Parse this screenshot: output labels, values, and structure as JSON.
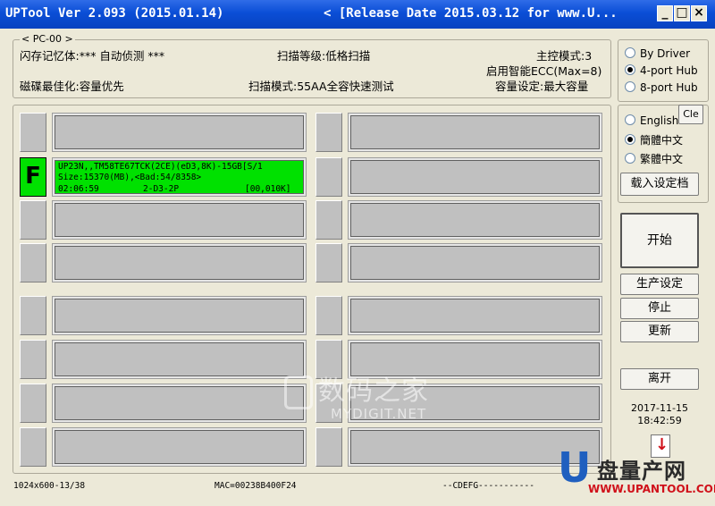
{
  "window": {
    "title": "UPTool Ver 2.093 (2015.01.14)",
    "title_right": "< [Release Date 2015.03.12 for www.U...",
    "minimize": "_",
    "maximize": "□",
    "close": "×"
  },
  "header": {
    "pc_label": "< PC-00 >",
    "flash_detect": "闪存记忆体:*** 自动侦测 ***",
    "scan_level": "扫描等级:低格扫描",
    "controller_mode": "主控模式:3",
    "ecc": "启用智能ECC(Max=8)",
    "optimize": "磁碟最佳化:容量优先",
    "scan_mode": "扫描模式:55AA全容快速测试",
    "capacity": "容量设定:最大容量"
  },
  "hub_options": {
    "selected": "4-port Hub",
    "items": [
      "By Driver",
      "4-port Hub",
      "8-port Hub"
    ]
  },
  "language_options": {
    "selected": "簡體中文",
    "items": [
      "English",
      "簡體中文",
      "繁體中文"
    ],
    "clear_button": "Cle",
    "load_button": "载入设定档"
  },
  "ports": {
    "active": {
      "status": "F",
      "line1": "UP23N,,TM58TE67TCK(2CE)(eD3,8K)-15GB[S/1",
      "line2": "Size:15370(MB),<Bad:54/8358>",
      "line3_time": "02:06:59",
      "line3_mode": "2-D3-2P",
      "line3_progress": "[00,010K]"
    }
  },
  "actions": {
    "start": "开始",
    "production_settings": "生产设定",
    "stop": "停止",
    "refresh": "更新",
    "exit": "离开"
  },
  "clock": {
    "date": "2017-11-15",
    "time": "18:42:59"
  },
  "statusbar": {
    "left": "1024x600-13/38",
    "mac": "MAC=00238B400F24",
    "right": "--CDEFG-----------"
  },
  "watermark": {
    "cn": "数码之家",
    "en": "MYDIGIT.NET"
  },
  "site_logo": {
    "text": "盘量产网",
    "url": "WWW.UPANTOOL.COM"
  }
}
